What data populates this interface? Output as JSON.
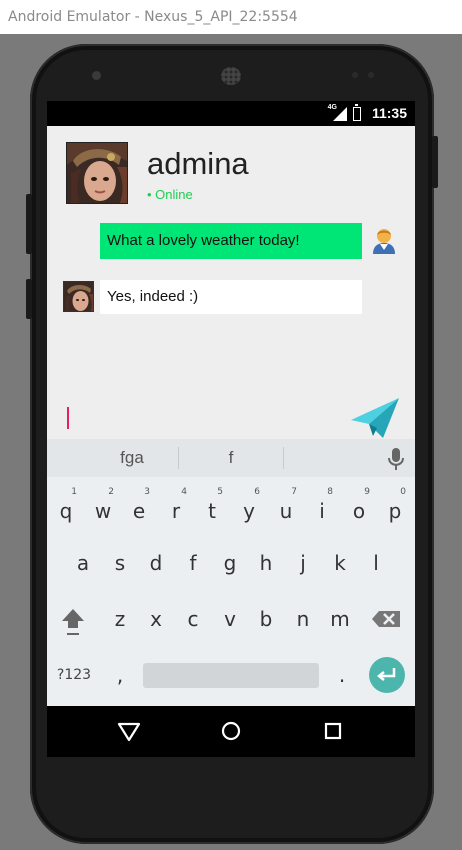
{
  "window": {
    "title": "Android Emulator - Nexus_5_API_22:5554"
  },
  "status_bar": {
    "network": "4G",
    "time": "11:35"
  },
  "chat": {
    "contact_name": "admina",
    "contact_status": "• Online",
    "messages": [
      {
        "sender": "me",
        "text": "What a lovely weather today!"
      },
      {
        "sender": "admina",
        "text": "Yes, indeed :)"
      }
    ]
  },
  "composer": {
    "value": "",
    "placeholder": ""
  },
  "keyboard": {
    "suggestions": [
      "fga",
      "f"
    ],
    "row1": [
      {
        "k": "q",
        "n": "1"
      },
      {
        "k": "w",
        "n": "2"
      },
      {
        "k": "e",
        "n": "3"
      },
      {
        "k": "r",
        "n": "4"
      },
      {
        "k": "t",
        "n": "5"
      },
      {
        "k": "y",
        "n": "6"
      },
      {
        "k": "u",
        "n": "7"
      },
      {
        "k": "i",
        "n": "8"
      },
      {
        "k": "o",
        "n": "9"
      },
      {
        "k": "p",
        "n": "0"
      }
    ],
    "row2": [
      "a",
      "s",
      "d",
      "f",
      "g",
      "h",
      "j",
      "k",
      "l"
    ],
    "row3": [
      "z",
      "x",
      "c",
      "v",
      "b",
      "n",
      "m"
    ],
    "symbols_label": "?123",
    "comma": ",",
    "period": "."
  },
  "colors": {
    "outgoing_bubble": "#00e676",
    "online": "#22cc55",
    "accent_input": "#e91e63",
    "enter_key": "#4db6ac"
  },
  "icons": {
    "send": "paper-plane-icon",
    "user": "user-icon",
    "mic": "microphone-icon",
    "shift": "shift-icon",
    "backspace": "backspace-icon",
    "enter": "enter-icon"
  }
}
